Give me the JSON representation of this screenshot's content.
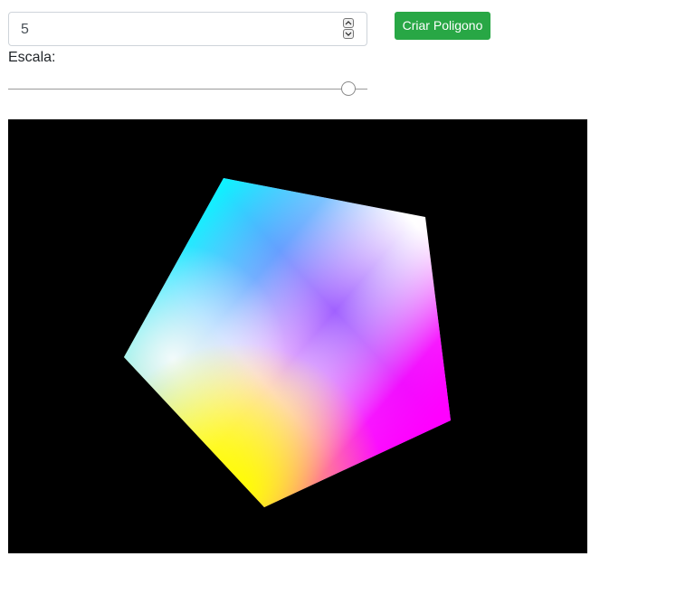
{
  "sides_input": {
    "value": "5"
  },
  "create_button": {
    "label": "Criar Poligono"
  },
  "scale": {
    "label": "Escala:",
    "value": 0.95
  },
  "canvas": {
    "background": "#000000",
    "polygon_colors": [
      "#ffff00",
      "#ffffff",
      "#00ffff",
      "#ff00ff"
    ]
  }
}
